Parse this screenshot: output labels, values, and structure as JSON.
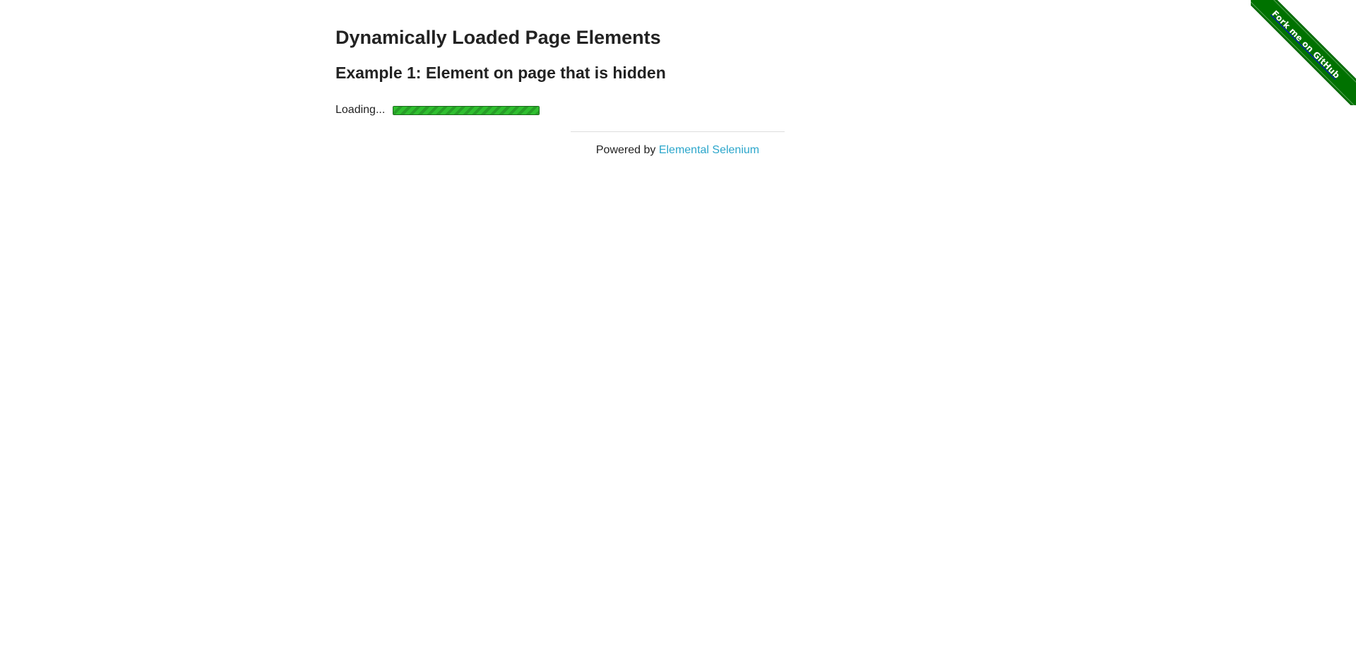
{
  "page": {
    "title": "Dynamically Loaded Page Elements",
    "subtitle": "Example 1: Element on page that is hidden"
  },
  "loading": {
    "label": "Loading...",
    "progress_percent": 100
  },
  "footer": {
    "powered_by": "Powered by",
    "link_text": "Elemental Selenium"
  },
  "ribbon": {
    "text": "Fork me on GitHub"
  },
  "colors": {
    "ribbon": "#007200",
    "progress": "#2fbf2f",
    "link": "#2ba6cb"
  }
}
